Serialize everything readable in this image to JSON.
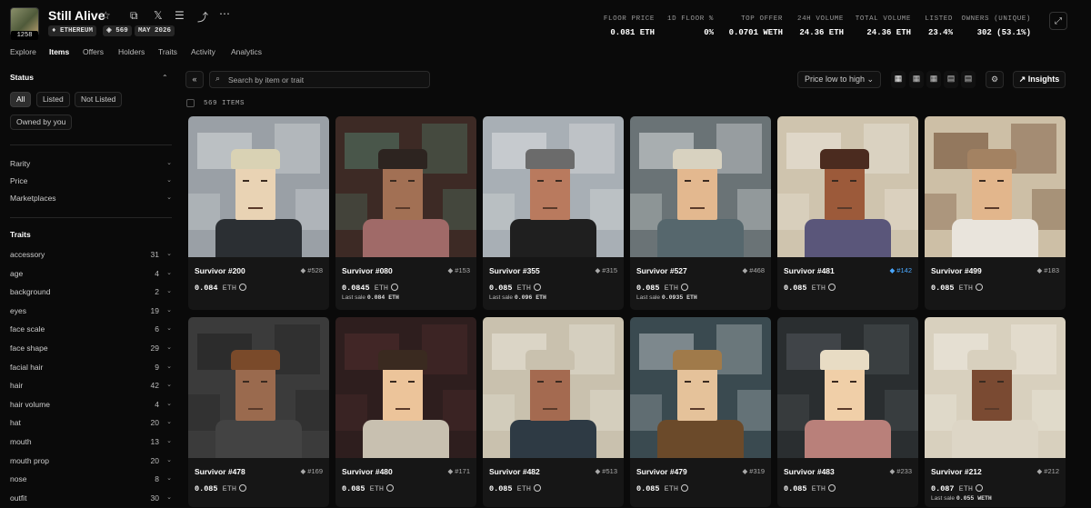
{
  "header": {
    "title": "Still Alive",
    "avatar_count": "1258",
    "chips": {
      "chain": "ETHEREUM",
      "items": "569",
      "date": "MAY 2026"
    },
    "stats": [
      {
        "label": "FLOOR PRICE",
        "value": "0.081 ETH"
      },
      {
        "label": "1D FLOOR %",
        "value": "0%"
      },
      {
        "label": "TOP OFFER",
        "value": "0.0701 WETH"
      },
      {
        "label": "24H VOLUME",
        "value": "24.36 ETH"
      },
      {
        "label": "TOTAL VOLUME",
        "value": "24.36 ETH"
      },
      {
        "label": "LISTED",
        "value": "23.4%"
      },
      {
        "label": "OWNERS (UNIQUE)",
        "value": "302 (53.1%)"
      }
    ]
  },
  "tabs": [
    "Explore",
    "Items",
    "Offers",
    "Holders",
    "Traits",
    "Activity",
    "Analytics"
  ],
  "sidebar": {
    "status_title": "Status",
    "status_pills": [
      "All",
      "Listed",
      "Not Listed",
      "Owned by you"
    ],
    "filters": [
      "Rarity",
      "Price",
      "Marketplaces"
    ],
    "traits_title": "Traits",
    "traits": [
      {
        "name": "accessory",
        "count": "31"
      },
      {
        "name": "age",
        "count": "4"
      },
      {
        "name": "background",
        "count": "2"
      },
      {
        "name": "eyes",
        "count": "19"
      },
      {
        "name": "face scale",
        "count": "6"
      },
      {
        "name": "face shape",
        "count": "29"
      },
      {
        "name": "facial hair",
        "count": "9"
      },
      {
        "name": "hair",
        "count": "42"
      },
      {
        "name": "hair volume",
        "count": "4"
      },
      {
        "name": "hat",
        "count": "20"
      },
      {
        "name": "mouth",
        "count": "13"
      },
      {
        "name": "mouth prop",
        "count": "20"
      },
      {
        "name": "nose",
        "count": "8"
      },
      {
        "name": "outfit",
        "count": "30"
      }
    ]
  },
  "toolbar": {
    "search_placeholder": "Search by item or trait",
    "sort_label": "Price low to high",
    "insights_label": "Insights",
    "items_count": "569 ITEMS"
  },
  "cards": [
    {
      "name": "Survivor #200",
      "rank": "528",
      "price": "0.084",
      "unit": "ETH",
      "last": "",
      "bg": "#9aa0a6",
      "bg2": "#c9cdd0",
      "face": "#e9d3b4",
      "hair": "#d9d2b4",
      "shirt": "#2b2f33",
      "blue": false
    },
    {
      "name": "Survivor #080",
      "rank": "153",
      "price": "0.0845",
      "unit": "ETH",
      "last": "0.084 ETH",
      "bg": "#3d2a25",
      "bg2": "#4e6a5a",
      "face": "#a27054",
      "hair": "#2d2420",
      "shirt": "#a06a68",
      "blue": false
    },
    {
      "name": "Survivor #355",
      "rank": "315",
      "price": "0.085",
      "unit": "ETH",
      "last": "0.096 ETH",
      "bg": "#a8afb5",
      "bg2": "#d3d6d8",
      "face": "#b97a5e",
      "hair": "#6b6b6b",
      "shirt": "#1f1f1f",
      "blue": false
    },
    {
      "name": "Survivor #527",
      "rank": "468",
      "price": "0.085",
      "unit": "ETH",
      "last": "0.0935 ETH",
      "bg": "#6a7376",
      "bg2": "#c3c8c9",
      "face": "#e3b88f",
      "hair": "#d8d2c0",
      "shirt": "#56676d",
      "blue": false
    },
    {
      "name": "Survivor #481",
      "rank": "142",
      "price": "0.085",
      "unit": "ETH",
      "last": "",
      "bg": "#cfc4ae",
      "bg2": "#e6e0d3",
      "face": "#9c5a3a",
      "hair": "#4b2b1f",
      "shirt": "#5a567a",
      "blue": true
    },
    {
      "name": "Survivor #499",
      "rank": "183",
      "price": "0.085",
      "unit": "ETH",
      "last": "",
      "bg": "#cdbfa6",
      "bg2": "#7b5a40",
      "face": "#e2b68c",
      "hair": "#a38262",
      "shirt": "#e9e4dc",
      "blue": false
    },
    {
      "name": "Survivor #478",
      "rank": "169",
      "price": "0.085",
      "unit": "ETH",
      "last": "",
      "bg": "#3b3b3b",
      "bg2": "#262626",
      "face": "#9a6a4e",
      "hair": "#7a4a2a",
      "shirt": "#434343",
      "blue": false
    },
    {
      "name": "Survivor #480",
      "rank": "171",
      "price": "0.085",
      "unit": "ETH",
      "last": "",
      "bg": "#2e1e1e",
      "bg2": "#4a2a2a",
      "face": "#ecc49a",
      "hair": "#3a2a20",
      "shirt": "#c8c0b0",
      "blue": false
    },
    {
      "name": "Survivor #482",
      "rank": "513",
      "price": "0.085",
      "unit": "ETH",
      "last": "",
      "bg": "#c9c1ae",
      "bg2": "#e2ddd0",
      "face": "#a46a50",
      "hair": "#c9c1ae",
      "shirt": "#2e3a44",
      "blue": false
    },
    {
      "name": "Survivor #479",
      "rank": "319",
      "price": "0.085",
      "unit": "ETH",
      "last": "",
      "bg": "#3a4a50",
      "bg2": "#9aa3a6",
      "face": "#e5c29a",
      "hair": "#a07a4a",
      "shirt": "#6b4a2a",
      "blue": false
    },
    {
      "name": "Survivor #483",
      "rank": "233",
      "price": "0.085",
      "unit": "ETH",
      "last": "",
      "bg": "#2a2e30",
      "bg2": "#4a4f52",
      "face": "#f0cfa8",
      "hair": "#e8dcc4",
      "shirt": "#b9807a",
      "blue": false
    },
    {
      "name": "Survivor #212",
      "rank": "212",
      "price": "0.087",
      "unit": "ETH",
      "last": "0.055 WETH",
      "bg": "#d8d0be",
      "bg2": "#ebe6da",
      "face": "#7a4a32",
      "hair": "#d8d0be",
      "shirt": "#ddd6c6",
      "blue": false
    }
  ]
}
